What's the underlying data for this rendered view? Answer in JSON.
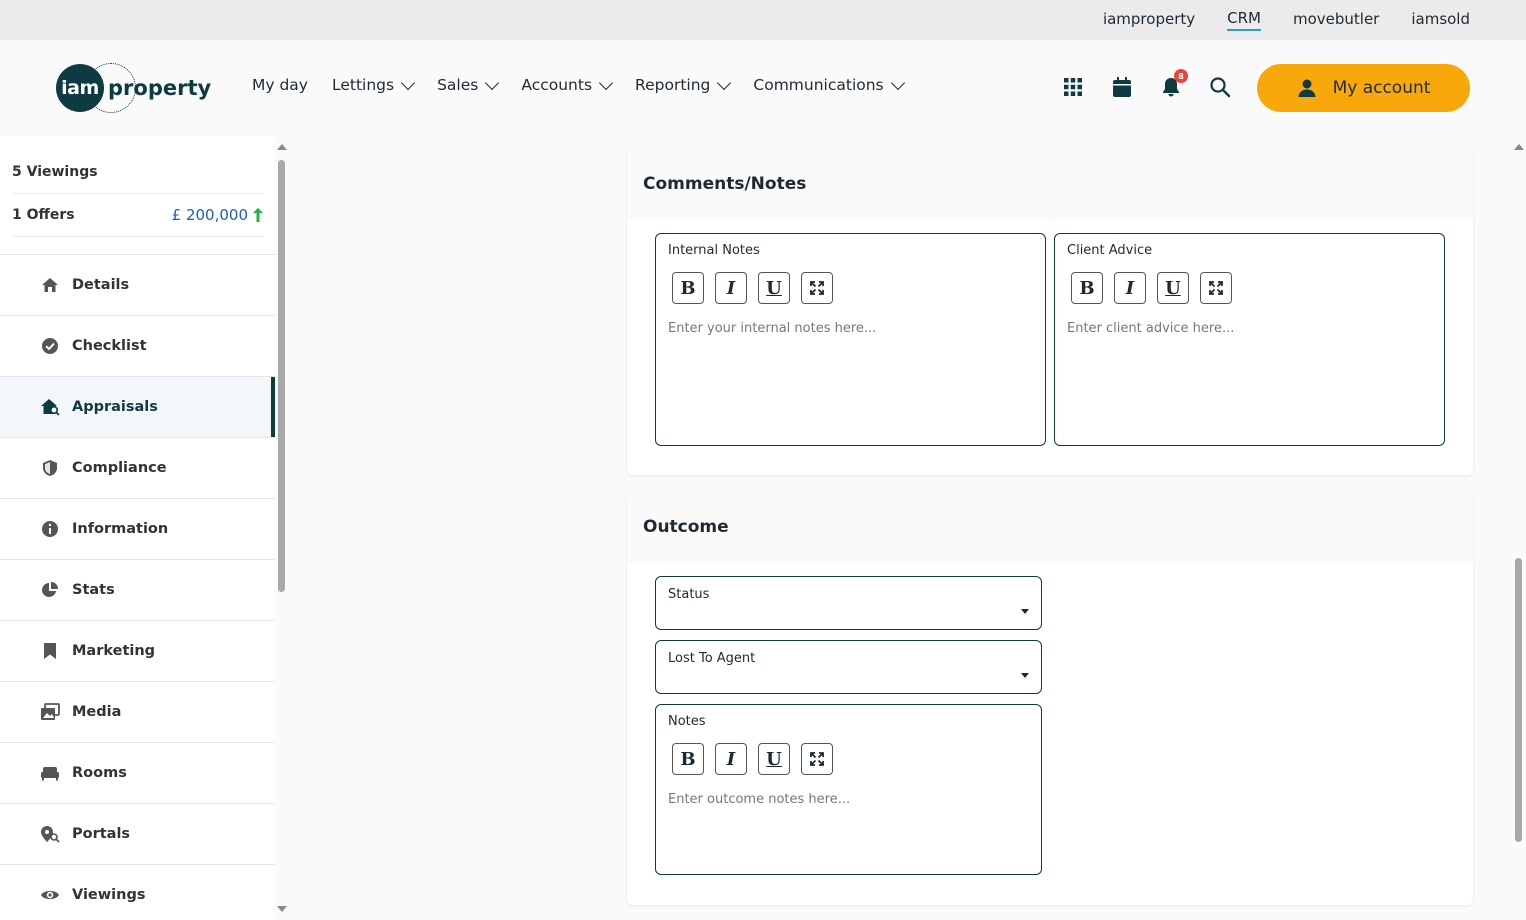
{
  "top_links": [
    "iamproperty",
    "CRM",
    "movebutler",
    "iamsold"
  ],
  "logo": {
    "mark": "iam",
    "word": "property"
  },
  "nav": {
    "myday": "My day",
    "lettings": "Lettings",
    "sales": "Sales",
    "accounts": "Accounts",
    "reporting": "Reporting",
    "communications": "Communications"
  },
  "notifications_count": "8",
  "my_account": "My account",
  "sidebar": {
    "viewings": "5 Viewings",
    "offers": "1 Offers",
    "offer_value": "£ 200,000",
    "items": [
      "Details",
      "Checklist",
      "Appraisals",
      "Compliance",
      "Information",
      "Stats",
      "Marketing",
      "Media",
      "Rooms",
      "Portals",
      "Viewings"
    ]
  },
  "comments_card": {
    "title": "Comments/Notes",
    "internal_label": "Internal Notes",
    "internal_placeholder": "Enter your internal notes here...",
    "client_label": "Client Advice",
    "client_placeholder": "Enter client advice here..."
  },
  "outcome_card": {
    "title": "Outcome",
    "status_label": "Status",
    "lost_label": "Lost To Agent",
    "notes_label": "Notes",
    "notes_placeholder": "Enter outcome notes here..."
  },
  "toolbar": {
    "bold": "B",
    "italic": "I",
    "underline": "U"
  },
  "colors": {
    "accent": "#f8a80b",
    "brand": "#0e3a42",
    "link_underline": "#2aa0c8",
    "offer": "#1f5fb0",
    "up_arrow": "#22b14c",
    "badge": "#e8463a"
  }
}
